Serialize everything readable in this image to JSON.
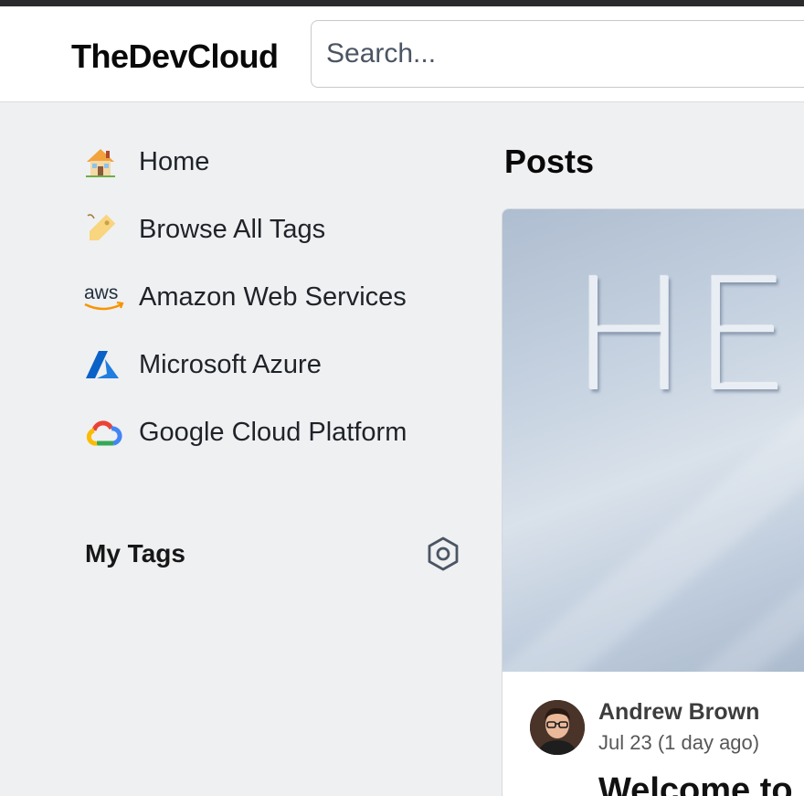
{
  "header": {
    "logo": "TheDevCloud",
    "search_placeholder": "Search..."
  },
  "sidebar": {
    "items": [
      {
        "label": "Home",
        "icon": "house-icon"
      },
      {
        "label": "Browse All Tags",
        "icon": "tag-icon"
      },
      {
        "label": "Amazon Web Services",
        "icon": "aws-logo-icon"
      },
      {
        "label": "Microsoft Azure",
        "icon": "azure-logo-icon"
      },
      {
        "label": "Google Cloud Platform",
        "icon": "google-cloud-logo-icon"
      }
    ],
    "my_tags_title": "My Tags",
    "aws_text": "aws"
  },
  "main": {
    "title": "Posts",
    "post": {
      "cover_text": "HEL",
      "author_name": "Andrew Brown",
      "date": "Jul 23 (1 day ago)",
      "title": "Welcome to"
    }
  },
  "colors": {
    "aws_orange": "#f79400",
    "azure_blue": "#0a62c8",
    "gcp_red": "#ea4335",
    "gcp_blue": "#4285f4",
    "gcp_yellow": "#fbbc05",
    "gcp_green": "#34a853"
  }
}
